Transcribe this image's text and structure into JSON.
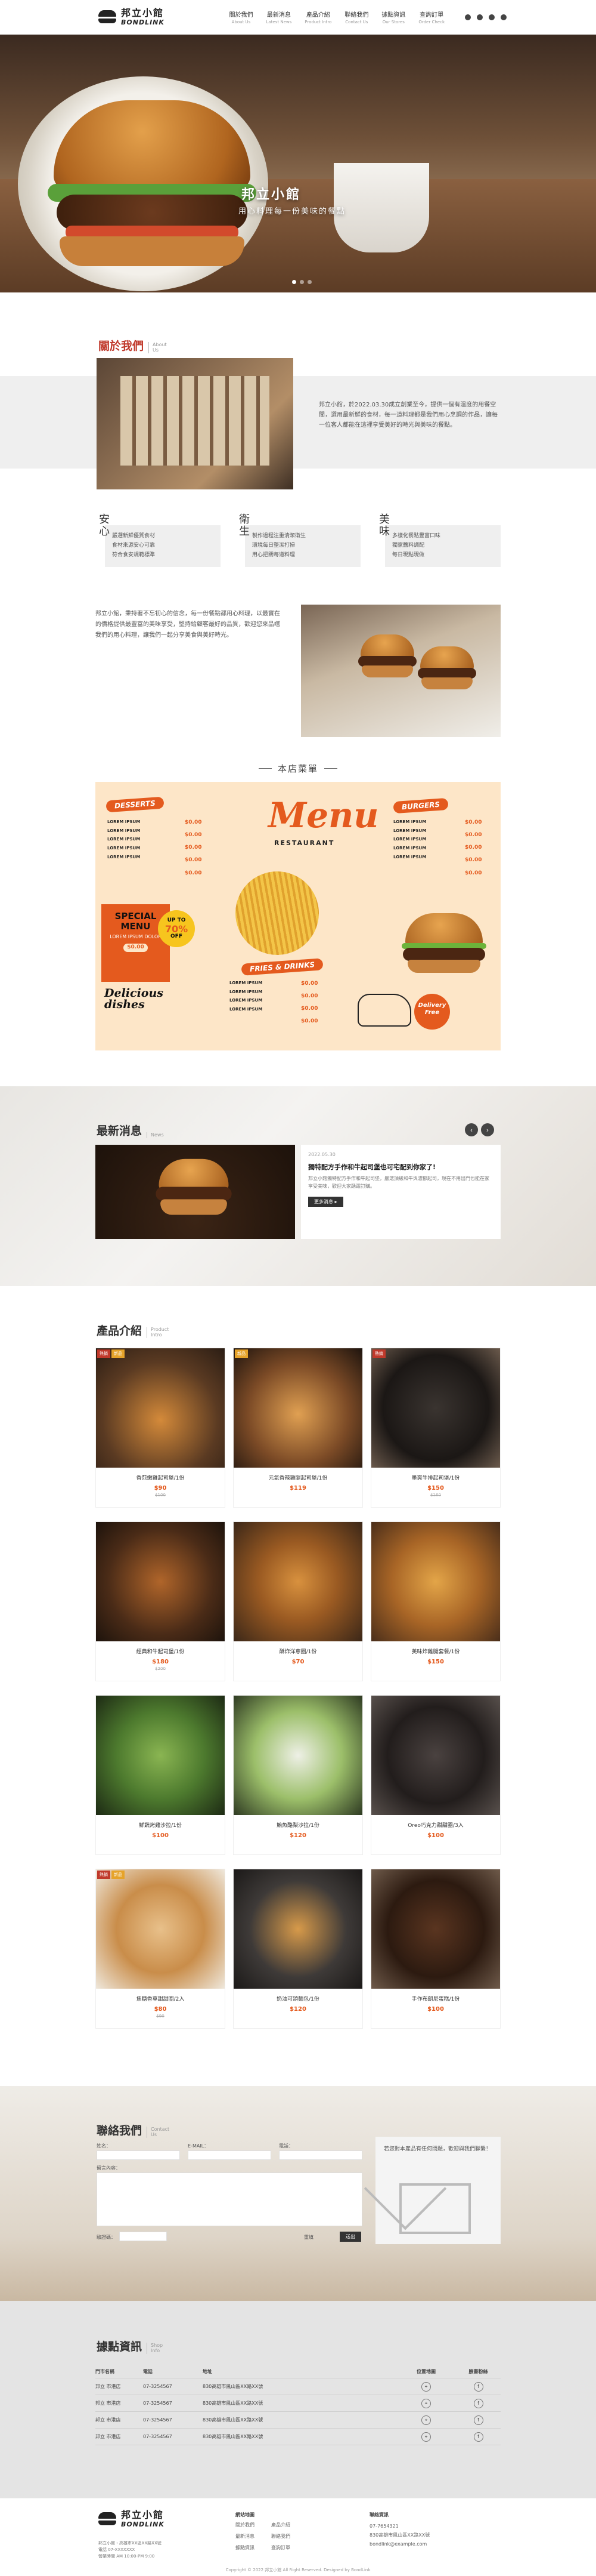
{
  "brand": {
    "name_cn": "邦立小館",
    "name_en": "BONDLINK"
  },
  "nav": [
    {
      "cn": "關於我們",
      "en": "About Us"
    },
    {
      "cn": "最新消息",
      "en": "Latest News"
    },
    {
      "cn": "產品介紹",
      "en": "Product Intro"
    },
    {
      "cn": "聯絡我們",
      "en": "Contact Us"
    },
    {
      "cn": "據點資訊",
      "en": "Our Stores"
    },
    {
      "cn": "查詢訂單",
      "en": "Order Check"
    }
  ],
  "nav_icons": [
    "facebook-icon",
    "line-icon",
    "user-icon",
    "cart-icon"
  ],
  "hero": {
    "tagline": "邦立小館",
    "sub": "用心料理每一份美味的餐點"
  },
  "about": {
    "title_cn": "關於我們",
    "title_en": "About",
    "title_en2": "Us",
    "text1": "邦立小館，於2022.03.30成立創業至今，提供一個有溫度的用餐空間，選用最新鮮的食材，每一道料理都是我們用心烹調的作品，讓每一位客人都能在這裡享受美好的時光與美味的餐點。",
    "cols": [
      {
        "head": "安心",
        "lines": [
          "嚴選新鮮優質食材",
          "食材來源安心可靠",
          "符合食安規範標準"
        ]
      },
      {
        "head": "衛生",
        "lines": [
          "製作過程注重清潔衛生",
          "環境每日整潔打掃",
          "用心把關每道料理"
        ]
      },
      {
        "head": "美味",
        "lines": [
          "多樣化餐點豐富口味",
          "獨家醬料調配",
          "每日現點現做"
        ]
      }
    ],
    "text2": "邦立小館，秉持著不忘初心的信念，每一份餐點都用心料理，以最實在的價格提供最豐富的美味享受，堅持給顧客最好的品質，歡迎您來品嚐我們的用心料理，讓我們一起分享美食與美好時光。"
  },
  "menu": {
    "title": "本店菜單",
    "word": "Menu",
    "restaurant": "RESTAURANT",
    "desserts": "DESSERTS",
    "burgers": "BURGERS",
    "fries": "FRIES & DRINKS",
    "item": "LOREM IPSUM",
    "price": "$0.00",
    "special_line1": "SPECIAL",
    "special_line2": "MENU",
    "special_sub": "LOREM IPSUM DOLOR",
    "special_btn": "$0.00",
    "off_top": "UP TO",
    "off_big": "70%",
    "off_bottom": "OFF",
    "delicious1": "Delicious",
    "delicious2": "dishes",
    "delivery1": "Delivery",
    "delivery2": "Free"
  },
  "news": {
    "title_cn": "最新消息",
    "title_en": "News",
    "date": "2022.05.30",
    "headline": "獨特配方手作和牛起司堡也可宅配到你家了!",
    "body": "邦立小館獨特配方手作和牛起司堡，嚴選頂級和牛與濃郁起司，現在不用出門也能在家享受美味，歡迎大家踴躍訂購。",
    "more": "更多消息 ▸",
    "prev": "‹",
    "next": "›"
  },
  "products": {
    "title_cn": "產品介紹",
    "title_en": "Product",
    "title_en2": "Intro",
    "hot": "熱銷",
    "new": "新品",
    "items": [
      {
        "name": "香煎嫩雞起司堡/1份",
        "price": "$90",
        "old": "$100"
      },
      {
        "name": "元氣香辣雞腿起司堡/1份",
        "price": "$119",
        "old": ""
      },
      {
        "name": "墨爽牛排起司堡/1份",
        "price": "$150",
        "old": "$160"
      },
      {
        "name": "經典和牛起司堡/1份",
        "price": "$180",
        "old": "$200"
      },
      {
        "name": "酥炸洋蔥圈/1份",
        "price": "$70",
        "old": ""
      },
      {
        "name": "美味炸雞腿套餐/1份",
        "price": "$150",
        "old": ""
      },
      {
        "name": "鮮蔬烤雞沙拉/1份",
        "price": "$100",
        "old": ""
      },
      {
        "name": "鮪魚酪梨沙拉/1份",
        "price": "$120",
        "old": ""
      },
      {
        "name": "Oreo巧克力甜甜圈/3入",
        "price": "$100",
        "old": ""
      },
      {
        "name": "焦糖香草甜甜圈/2入",
        "price": "$80",
        "old": "$90"
      },
      {
        "name": "奶油可頌麵包/1份",
        "price": "$120",
        "old": ""
      },
      {
        "name": "手作布朗尼蛋糕/1份",
        "price": "$100",
        "old": ""
      }
    ]
  },
  "contact": {
    "title_cn": "聯絡我們",
    "title_en": "Contact",
    "title_en2": "Us",
    "name": "姓名：",
    "email": "E-MAIL：",
    "phone": "電話：",
    "message": "留言內容：",
    "captcha": "驗證碼：",
    "send": "送出",
    "reset": "重填",
    "mail_note": "若您對本產品有任何問題，歡迎與我們聯繫！"
  },
  "locations": {
    "title_cn": "據點資訊",
    "title_en": "Shop",
    "title_en2": "Info",
    "headers": [
      "門市名稱",
      "電話",
      "地址",
      "位置地圖",
      "臉書粉絲"
    ],
    "rows": [
      {
        "name": "邦立 市港店",
        "tel": "07-3254567",
        "addr": "830高雄市鳳山區XX路XX號"
      },
      {
        "name": "邦立 市港店",
        "tel": "07-3254567",
        "addr": "830高雄市鳳山區XX路XX號"
      },
      {
        "name": "邦立 市港店",
        "tel": "07-3254567",
        "addr": "830高雄市鳳山區XX路XX號"
      },
      {
        "name": "邦立 市港店",
        "tel": "07-3254567",
        "addr": "830高雄市鳳山區XX路XX號"
      }
    ]
  },
  "footer": {
    "addr1": "邦立小館・高雄市XX區XX路XX號",
    "addr2": "電話 07-XXXXXXX",
    "addr3": "營業時間 AM 10:00-PM 9:00",
    "links_head": "網站地圖",
    "links": [
      "關於我們",
      "產品介紹",
      "最新消息",
      "聯絡我們",
      "據點資訊",
      "查詢訂單"
    ],
    "contact_head": "聯絡資訊",
    "phone": "07-7654321",
    "address": "830高雄市鳳山區XX路XX號",
    "email": "bondlink@example.com",
    "copyright": "Copyright © 2022 邦立小館 All Right Reserved. Designed by BondLink"
  },
  "colors": {
    "accent": "#e45a1e",
    "title_red": "#c0392b",
    "dark": "#333333",
    "menu_bg": "#fde6c8"
  }
}
